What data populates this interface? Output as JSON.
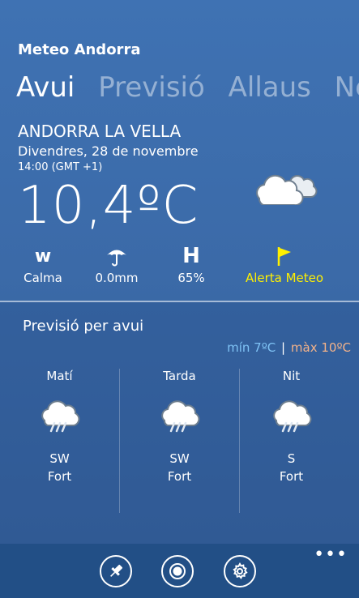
{
  "app": {
    "title": "Meteo Andorra"
  },
  "pivot": {
    "tabs": [
      "Avui",
      "Previsió",
      "Allaus",
      "Neu"
    ],
    "active_index": 0
  },
  "current": {
    "city": "ANDORRA LA VELLA",
    "date": "Divendres, 28 de novembre",
    "time": "14:00 (GMT +1)",
    "temperature": "10,4ºC",
    "condition_icon": "cloudy-icon"
  },
  "metrics": {
    "wind": {
      "glyph": "w",
      "label": "Calma",
      "icon": "wind-icon"
    },
    "rain": {
      "label": "0.0mm",
      "icon": "umbrella-icon"
    },
    "humidity": {
      "glyph": "H",
      "label": "65%",
      "icon": "humidity-icon"
    },
    "alert": {
      "label": "Alerta Meteo",
      "icon": "flag-icon",
      "color": "#fff000"
    }
  },
  "forecast": {
    "title": "Previsió per avui",
    "min_label": "mín",
    "min_value": "7ºC",
    "separator": "|",
    "max_label": "màx",
    "max_value": "10ºC",
    "periods": [
      {
        "name": "Matí",
        "icon": "rain-cloud-icon",
        "wind_dir": "SW",
        "wind_strength": "Fort"
      },
      {
        "name": "Tarda",
        "icon": "rain-cloud-icon",
        "wind_dir": "SW",
        "wind_strength": "Fort"
      },
      {
        "name": "Nit",
        "icon": "rain-cloud-icon",
        "wind_dir": "S",
        "wind_strength": "Fort"
      }
    ]
  },
  "appbar": {
    "buttons": [
      "pin-icon",
      "record-icon",
      "settings-icon"
    ],
    "more": "•••"
  },
  "colors": {
    "accent_alert": "#fff000",
    "min": "#7fc3f5",
    "max": "#f2b28a"
  }
}
